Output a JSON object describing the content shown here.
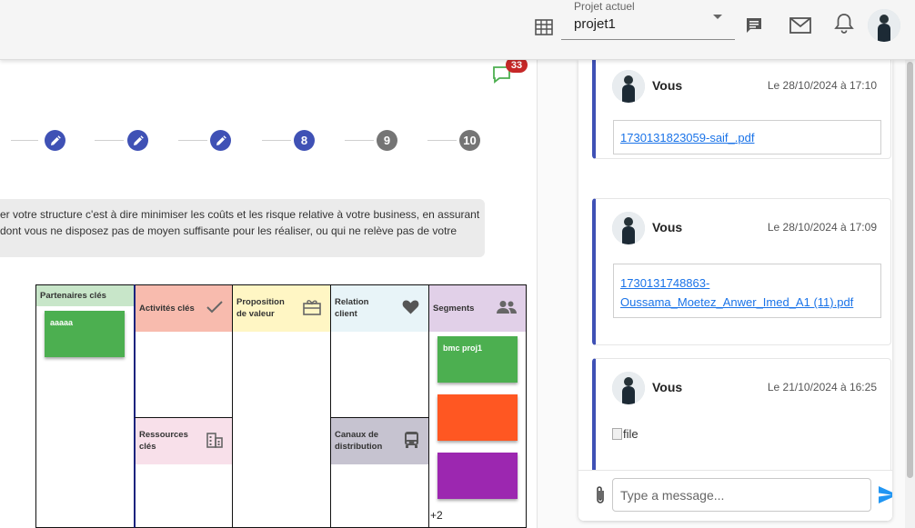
{
  "header": {
    "project_label": "Projet actuel",
    "project_value": "projet1",
    "icons": [
      "table-icon",
      "chat-icon",
      "mail-icon",
      "bell-icon",
      "avatar"
    ]
  },
  "comments": {
    "count": "33"
  },
  "stepper": {
    "steps": [
      {
        "label": "",
        "state": "done",
        "icon": "pencil-icon"
      },
      {
        "label": "",
        "state": "done",
        "icon": "pencil-icon"
      },
      {
        "label": "",
        "state": "done",
        "icon": "pencil-icon"
      },
      {
        "label": "8",
        "state": "active"
      },
      {
        "label": "9",
        "state": "todo"
      },
      {
        "label": "10",
        "state": "todo"
      }
    ]
  },
  "info": {
    "line1": "er votre structure c'est à dire minimiser les coûts et les risque relative à votre business, en assurant",
    "line2": "dont vous ne disposez pas de moyen suffisante pour les réaliser, ou qui ne relève pas de votre"
  },
  "canvas": {
    "partners": {
      "title": "Partenaires clés",
      "note": "aaaaa"
    },
    "activities": {
      "title": "Activités clés"
    },
    "resources": {
      "title_l1": "Ressources",
      "title_l2": "clés"
    },
    "value": {
      "title_l1": "Proposition",
      "title_l2": "de valeur"
    },
    "relation": {
      "title_l1": "Relation",
      "title_l2": "client"
    },
    "channels": {
      "title_l1": "Canaux de",
      "title_l2": "distribution"
    },
    "segments": {
      "title": "Segments",
      "note": "bmc proj1",
      "more": "+2"
    },
    "colors": {
      "partners": "#c8e6c9",
      "activities": "#f8bbae",
      "resources": "#f8e0ea",
      "value": "#fff6c4",
      "relation": "#e8f4f8",
      "channels": "#c6c3d0",
      "segments": "#e1d0e8",
      "note_green": "#4caf50",
      "note_orange": "#ff5722",
      "note_purple": "#9c27b0"
    }
  },
  "chat": {
    "messages": [
      {
        "author": "Vous",
        "time": "Le 28/10/2024 à 17:10",
        "file": "1730131823059-saif_.pdf"
      },
      {
        "author": "Vous",
        "time": "Le 28/10/2024 à 17:09",
        "file_l1": "1730131748863-",
        "file_l2": "Oussama_Moetez_Anwer_Imed_A1 (11).pdf"
      },
      {
        "author": "Vous",
        "time": "Le 21/10/2024 à 16:25",
        "image_alt": "file"
      }
    ],
    "input_placeholder": "Type a message...",
    "accent": "#3f51b5",
    "send_color": "#2196f3"
  }
}
